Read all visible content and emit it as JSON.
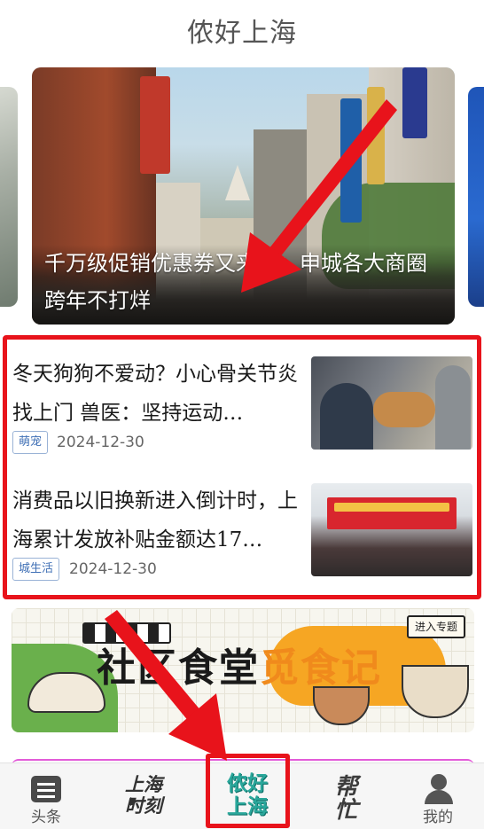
{
  "header": {
    "title": "侬好上海"
  },
  "hero": {
    "caption": "千万级促销优惠券又来了：申城各大商圈跨年不打烊"
  },
  "news": [
    {
      "title": "冬天狗狗不爱动？小心骨关节炎找上门 兽医：坚持运动…",
      "tag": "萌宠",
      "date": "2024-12-30",
      "thumb_icon": "dog-photo"
    },
    {
      "title": "消费品以旧换新进入倒计时，上海累计发放补贴金额达17…",
      "tag": "城生活",
      "date": "2024-12-30",
      "thumb_icon": "conference-photo"
    }
  ],
  "promo": {
    "title_main": "社区食堂",
    "title_highlight": "觅食记",
    "badge": "进入专题"
  },
  "tabbar": {
    "items": [
      {
        "label": "头条",
        "icon": "news-icon"
      },
      {
        "label": "上海时刻",
        "icon": "shanghai-moment-logo"
      },
      {
        "label": "侬好上海",
        "icon": "nonghao-shanghai-logo",
        "active": true
      },
      {
        "label": "帮忙",
        "icon": "bangmang-logo"
      },
      {
        "label": "我的",
        "icon": "person-icon"
      }
    ],
    "logo_sh_line1": "上海",
    "logo_sh_line2": "时刻",
    "logo_nh_line1": "侬好",
    "logo_nh_line2": "上海",
    "logo_bm": "帮忙"
  },
  "annotation_color": "#e8131b"
}
